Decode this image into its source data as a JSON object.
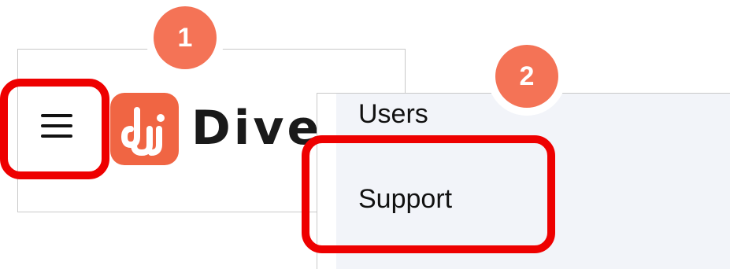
{
  "header": {
    "brand_name": "Diver",
    "logo_color": "#f06543"
  },
  "menu": {
    "items": [
      {
        "label": "Users"
      },
      {
        "label": "Support"
      }
    ]
  },
  "annotations": {
    "step_1": "1",
    "step_2": "2",
    "highlight_color": "#ee0000",
    "badge_color": "#f47356"
  },
  "icons": [
    "hamburger-menu-icon",
    "brand-logo-icon"
  ]
}
